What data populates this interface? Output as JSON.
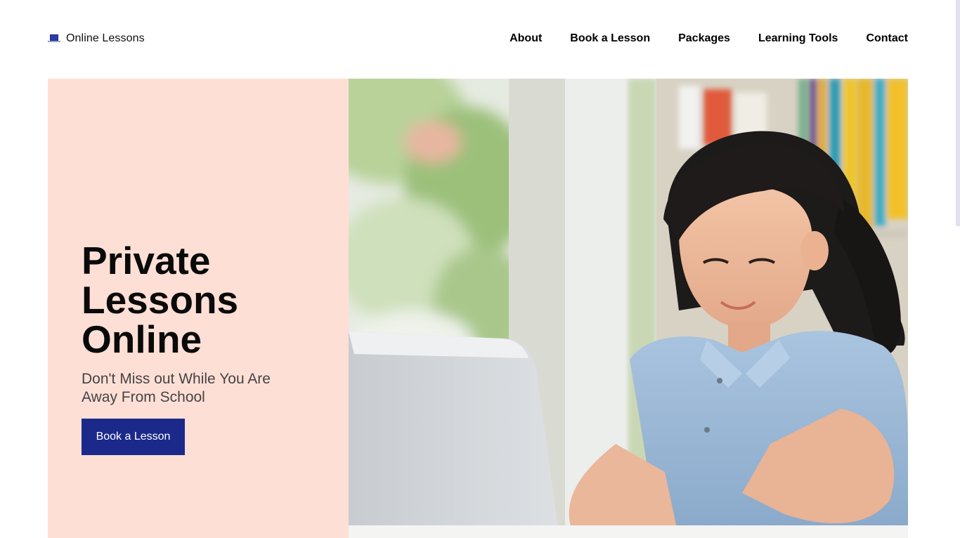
{
  "brand": {
    "name": "Online Lessons",
    "icon": "laptop-icon",
    "accent": "#1b2a8a"
  },
  "nav": {
    "items": [
      {
        "label": "About"
      },
      {
        "label": "Book a Lesson"
      },
      {
        "label": "Packages"
      },
      {
        "label": "Learning Tools"
      },
      {
        "label": "Contact"
      }
    ]
  },
  "hero": {
    "title": "Private\nLessons\nOnline",
    "subtitle": "Don't Miss out While You Are Away From School",
    "button_label": "Book a Lesson",
    "panel_color": "#fedfd6",
    "button_color": "#1b2a8a"
  }
}
